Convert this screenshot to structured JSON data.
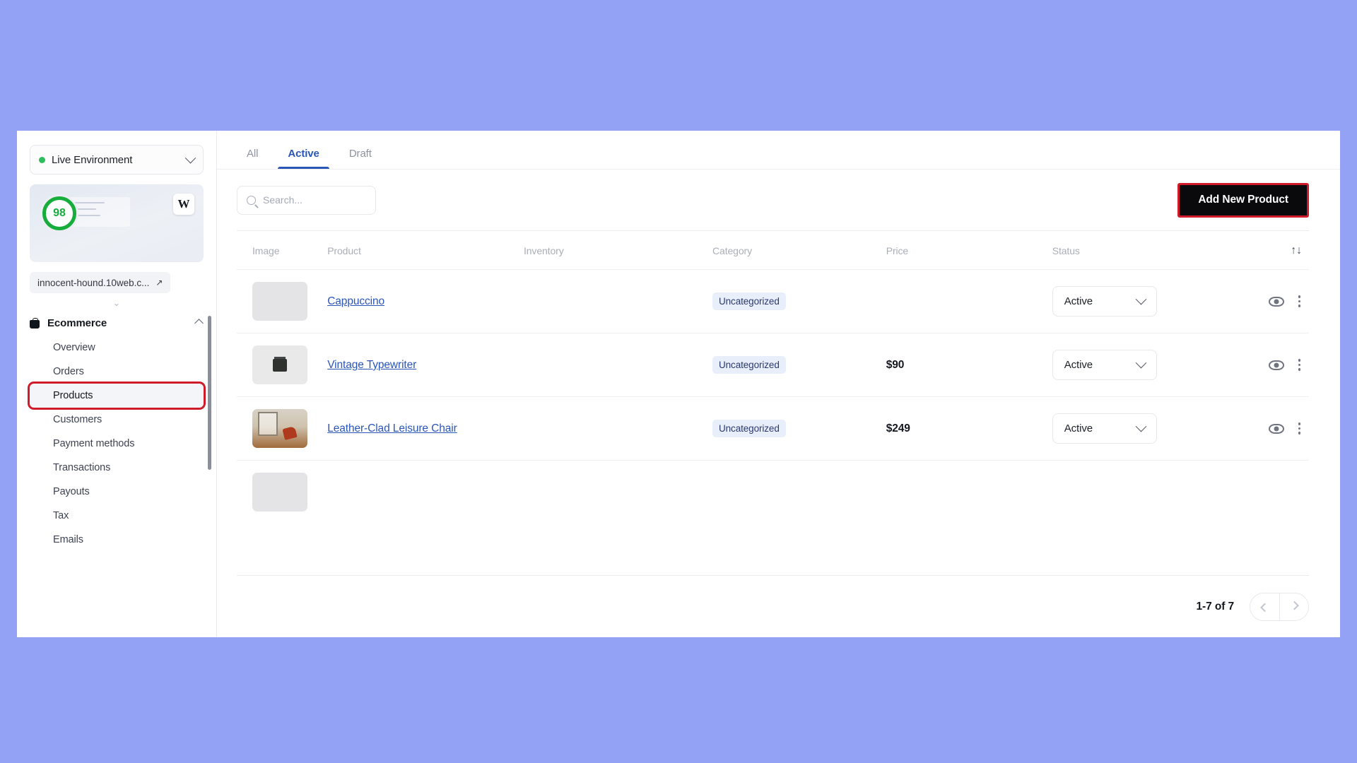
{
  "sidebar": {
    "environment": {
      "label": "Live Environment",
      "status_color": "#2dbd5c",
      "caret_icon": "chevron-down-icon"
    },
    "preview": {
      "score": "98",
      "score_color": "#17ad3d",
      "platform_badge": "W"
    },
    "site_url": {
      "label": "innocent-hound.10web.c...",
      "external_icon": "↗"
    },
    "group": {
      "title": "Ecommerce",
      "icon": "shopping-bag-icon",
      "expanded_caret": "chevron-up-icon"
    },
    "items": [
      {
        "label": "Overview",
        "active": false
      },
      {
        "label": "Orders",
        "active": false
      },
      {
        "label": "Products",
        "active": true
      },
      {
        "label": "Customers",
        "active": false
      },
      {
        "label": "Payment methods",
        "active": false
      },
      {
        "label": "Transactions",
        "active": false
      },
      {
        "label": "Payouts",
        "active": false
      },
      {
        "label": "Tax",
        "active": false
      },
      {
        "label": "Emails",
        "active": false
      }
    ]
  },
  "tabs": [
    {
      "label": "All",
      "active": false
    },
    {
      "label": "Active",
      "active": true
    },
    {
      "label": "Draft",
      "active": false
    }
  ],
  "toolbar": {
    "search_placeholder": "Search...",
    "search_value": "",
    "search_icon": "search-icon",
    "add_button_label": "Add New Product",
    "add_button_bg": "#0a0a0c",
    "highlight_color": "#d01b2a"
  },
  "table": {
    "columns": [
      "Image",
      "Product",
      "Inventory",
      "Category",
      "Price",
      "Status"
    ],
    "sort_icon": "↑↓",
    "rows": [
      {
        "thumb": "placeholder",
        "product": "Cappuccino",
        "inventory": "",
        "category": "Uncategorized",
        "price": "",
        "status": "Active",
        "view_icon": "eye-icon",
        "menu_icon": "kebab-menu-icon"
      },
      {
        "thumb": "typewriter",
        "product": "Vintage Typewriter",
        "inventory": "",
        "category": "Uncategorized",
        "price": "$90",
        "status": "Active",
        "view_icon": "eye-icon",
        "menu_icon": "kebab-menu-icon"
      },
      {
        "thumb": "chair",
        "product": "Leather-Clad Leisure Chair",
        "inventory": "",
        "category": "Uncategorized",
        "price": "$249",
        "status": "Active",
        "view_icon": "eye-icon",
        "menu_icon": "kebab-menu-icon"
      }
    ]
  },
  "footer": {
    "page_count": "1-7 of 7",
    "prev_icon": "chevron-left-icon",
    "next_icon": "chevron-right-icon"
  }
}
